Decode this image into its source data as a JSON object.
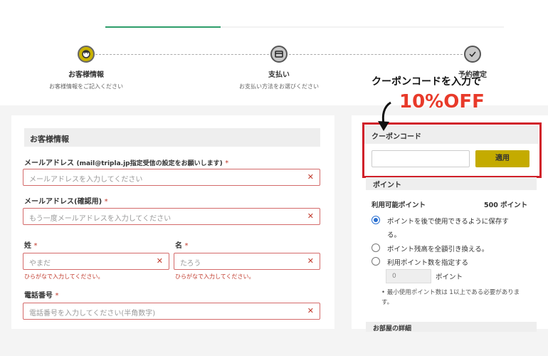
{
  "stepper": {
    "steps": [
      {
        "title": "お客様情報",
        "subtitle": "お客様情報をご記入ください"
      },
      {
        "title": "支払い",
        "subtitle": "お支払い方法をお選びください"
      },
      {
        "title": "予約確定",
        "subtitle": ""
      }
    ]
  },
  "promo": {
    "line1": "クーポンコードを入力で",
    "line2": "10%OFF",
    "accent_color": "#e83a2a"
  },
  "form": {
    "section_title": "お客様情報",
    "email": {
      "label": "メールアドレス",
      "label_note": "(mail@tripla.jp指定受信の設定をお願いします)",
      "required": "*",
      "placeholder": "メールアドレスを入力してください"
    },
    "email_confirm": {
      "label": "メールアドレス(確認用)",
      "required": "*",
      "placeholder": "もう一度メールアドレスを入力してください"
    },
    "last_name": {
      "label": "姓",
      "required": "*",
      "placeholder": "やまだ",
      "hint": "ひらがなで入力してください。"
    },
    "first_name": {
      "label": "名",
      "required": "*",
      "placeholder": "たろう",
      "hint": "ひらがなで入力してください。"
    },
    "phone": {
      "label": "電話番号",
      "required": "*",
      "placeholder": "電話番号を入力してください(半角数字)"
    },
    "clear_icon": "✕",
    "error_color": "#c0392b"
  },
  "coupon": {
    "title": "クーポンコード",
    "input_value": "",
    "apply_label": "適用",
    "button_color": "#c4ab00"
  },
  "points": {
    "title": "ポイント",
    "available_label": "利用可能ポイント",
    "available_value": "500 ポイント",
    "options": [
      {
        "label": "ポイントを後で使用できるように保存す",
        "label_cont": "る。",
        "checked": true
      },
      {
        "label": "ポイント残高を全額引き換える。",
        "checked": false
      },
      {
        "label": "利用ポイント数を指定する",
        "checked": false
      }
    ],
    "amount_value": "0",
    "amount_unit": "ポイント",
    "note": "• 最小使用ポイント数は 1以上である必要がありま す。"
  },
  "room": {
    "title": "お部屋の詳細"
  }
}
